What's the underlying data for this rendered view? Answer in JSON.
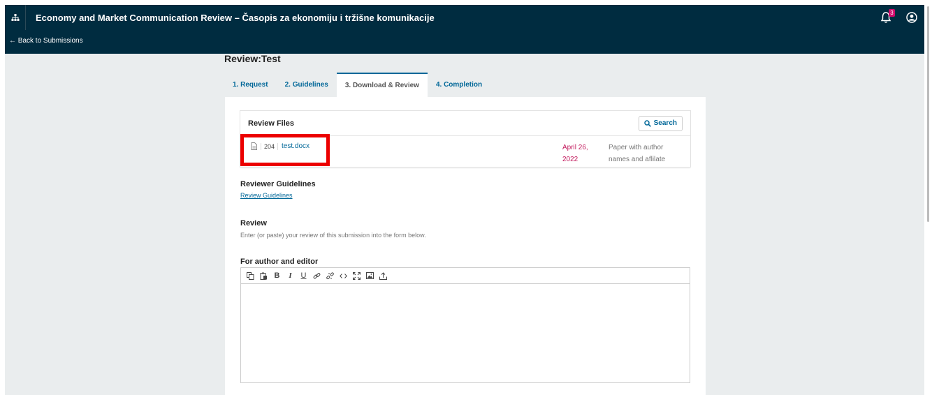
{
  "header": {
    "site_title": "Economy and Market Communication Review – Časopis za ekonomiju i tržišne komunikacije",
    "notification_count": "3",
    "back_link": "← Back to Submissions"
  },
  "page": {
    "title": "Review:Test"
  },
  "tabs": [
    {
      "label": "1. Request",
      "active": false
    },
    {
      "label": "2. Guidelines",
      "active": false
    },
    {
      "label": "3. Download & Review",
      "active": true
    },
    {
      "label": "4. Completion",
      "active": false
    }
  ],
  "review_files": {
    "title": "Review Files",
    "search_label": "Search",
    "files": [
      {
        "id": "204",
        "name": "test.docx",
        "date": "April 26, 2022",
        "description": "Paper with author names and aflilate"
      }
    ]
  },
  "reviewer_guidelines": {
    "title": "Reviewer Guidelines",
    "link": "Review Guidelines"
  },
  "review": {
    "title": "Review",
    "description": "Enter (or paste) your review of this submission into the form below."
  },
  "editor": {
    "label": "For author and editor",
    "toolbar": [
      "copy-icon",
      "paste-icon",
      "bold-icon",
      "italic-icon",
      "underline-icon",
      "link-icon",
      "unlink-icon",
      "code-icon",
      "fullscreen-icon",
      "image-icon",
      "upload-icon"
    ],
    "value": ""
  },
  "colors": {
    "header": "#002c40",
    "accent": "#006798",
    "date": "#c2185b",
    "badge": "#d00a6c",
    "highlight": "#ec0000"
  }
}
